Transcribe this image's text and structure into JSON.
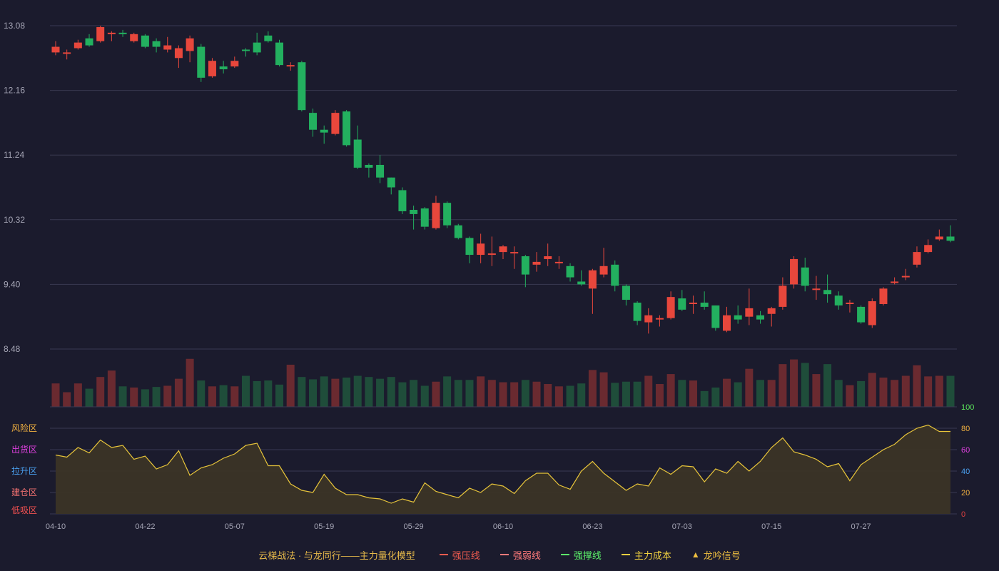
{
  "legend": {
    "title": "云梯战法 · 与龙同行——主力量化模型",
    "items": [
      {
        "label": "强压线",
        "color": "#f05b4f",
        "style": "solid"
      },
      {
        "label": "强弱线",
        "color": "#ff7a7a",
        "style": "dashed"
      },
      {
        "label": "强撑线",
        "color": "#5cf26a",
        "style": "solid"
      },
      {
        "label": "主力成本",
        "color": "#f0d040",
        "style": "dashed"
      },
      {
        "label": "龙吟信号",
        "color": "#f0c040",
        "style": "triangle"
      }
    ]
  },
  "colors": {
    "up": "#e8473c",
    "down": "#23b05f",
    "volume_up": "#6a2a30",
    "volume_down": "#1f4d3a",
    "grid": "#3a3a52",
    "axis_text": "#a5a5b5",
    "oscillator_line": "#e8c53a",
    "oscillator_fill": "#3b3426",
    "osc_100": "#5ce85c",
    "osc_80": "#f0b040",
    "osc_60": "#e040e0",
    "osc_40": "#4aa0f0",
    "osc_20": "#f0b040",
    "osc_0": "#e04040"
  },
  "chart_data": [
    {
      "type": "candlestick",
      "ylim": [
        8.48,
        13.08
      ],
      "y_ticks": [
        "13.08",
        "12.16",
        "11.24",
        "10.32",
        "9.40",
        "8.48"
      ],
      "x_ticks": [
        {
          "index": 0,
          "label": "04-10"
        },
        {
          "index": 8,
          "label": "04-22"
        },
        {
          "index": 16,
          "label": "05-07"
        },
        {
          "index": 24,
          "label": "05-19"
        },
        {
          "index": 32,
          "label": "05-29"
        },
        {
          "index": 40,
          "label": "06-10"
        },
        {
          "index": 48,
          "label": "06-23"
        },
        {
          "index": 56,
          "label": "07-03"
        },
        {
          "index": 64,
          "label": "07-15"
        },
        {
          "index": 72,
          "label": "07-27"
        }
      ],
      "ohlc": [
        [
          12.7,
          12.78,
          12.86,
          12.66
        ],
        [
          12.68,
          12.7,
          12.74,
          12.6
        ],
        [
          12.76,
          12.84,
          12.88,
          12.74
        ],
        [
          12.9,
          12.8,
          12.96,
          12.78
        ],
        [
          12.86,
          13.06,
          13.08,
          12.84
        ],
        [
          12.98,
          12.98,
          13.0,
          12.86
        ],
        [
          12.98,
          12.96,
          13.02,
          12.92
        ],
        [
          12.86,
          12.96,
          12.98,
          12.84
        ],
        [
          12.94,
          12.78,
          12.96,
          12.76
        ],
        [
          12.86,
          12.78,
          12.9,
          12.7
        ],
        [
          12.74,
          12.8,
          12.92,
          12.7
        ],
        [
          12.62,
          12.76,
          12.8,
          12.48
        ],
        [
          12.72,
          12.9,
          12.94,
          12.56
        ],
        [
          12.78,
          12.34,
          12.82,
          12.28
        ],
        [
          12.36,
          12.58,
          12.62,
          12.34
        ],
        [
          12.5,
          12.46,
          12.58,
          12.4
        ],
        [
          12.5,
          12.58,
          12.64,
          12.48
        ],
        [
          12.74,
          12.72,
          12.76,
          12.64
        ],
        [
          12.84,
          12.7,
          12.98,
          12.66
        ],
        [
          12.94,
          12.86,
          13.0,
          12.84
        ],
        [
          12.84,
          12.52,
          12.88,
          12.5
        ],
        [
          12.52,
          12.52,
          12.56,
          12.44
        ],
        [
          12.56,
          11.88,
          12.58,
          11.86
        ],
        [
          11.84,
          11.6,
          11.9,
          11.5
        ],
        [
          11.6,
          11.56,
          11.66,
          11.4
        ],
        [
          11.54,
          11.84,
          11.88,
          11.52
        ],
        [
          11.86,
          11.38,
          11.88,
          11.36
        ],
        [
          11.46,
          11.06,
          11.66,
          11.04
        ],
        [
          11.1,
          11.06,
          11.12,
          10.92
        ],
        [
          11.1,
          10.92,
          11.24,
          10.84
        ],
        [
          10.92,
          10.78,
          10.92,
          10.68
        ],
        [
          10.74,
          10.44,
          10.78,
          10.4
        ],
        [
          10.46,
          10.4,
          10.52,
          10.18
        ],
        [
          10.48,
          10.22,
          10.5,
          10.18
        ],
        [
          10.2,
          10.56,
          10.66,
          10.18
        ],
        [
          10.56,
          10.24,
          10.58,
          10.2
        ],
        [
          10.24,
          10.06,
          10.26,
          10.04
        ],
        [
          10.06,
          9.82,
          10.08,
          9.7
        ],
        [
          9.82,
          9.98,
          10.12,
          9.7
        ],
        [
          9.84,
          9.84,
          10.08,
          9.66
        ],
        [
          9.86,
          9.94,
          9.96,
          9.76
        ],
        [
          9.84,
          9.86,
          9.94,
          9.62
        ],
        [
          9.8,
          9.54,
          9.82,
          9.36
        ],
        [
          9.68,
          9.72,
          9.86,
          9.58
        ],
        [
          9.76,
          9.8,
          9.98,
          9.66
        ],
        [
          9.72,
          9.72,
          9.8,
          9.62
        ],
        [
          9.66,
          9.5,
          9.7,
          9.44
        ],
        [
          9.44,
          9.4,
          9.6,
          9.38
        ],
        [
          9.34,
          9.6,
          9.62,
          8.98
        ],
        [
          9.54,
          9.66,
          9.92,
          9.5
        ],
        [
          9.68,
          9.38,
          9.74,
          9.3
        ],
        [
          9.38,
          9.18,
          9.4,
          9.1
        ],
        [
          9.14,
          8.88,
          9.16,
          8.82
        ],
        [
          8.86,
          8.96,
          9.06,
          8.7
        ],
        [
          8.92,
          8.92,
          8.96,
          8.8
        ],
        [
          8.92,
          9.22,
          9.3,
          8.9
        ],
        [
          9.2,
          9.04,
          9.32,
          9.02
        ],
        [
          9.12,
          9.14,
          9.24,
          8.98
        ],
        [
          9.14,
          9.08,
          9.3,
          9.04
        ],
        [
          9.1,
          8.78,
          9.1,
          8.74
        ],
        [
          8.74,
          8.96,
          9.08,
          8.72
        ],
        [
          8.96,
          8.9,
          9.1,
          8.84
        ],
        [
          8.94,
          9.06,
          9.34,
          8.82
        ],
        [
          8.96,
          8.9,
          9.02,
          8.84
        ],
        [
          8.98,
          9.06,
          9.08,
          8.8
        ],
        [
          9.08,
          9.38,
          9.5,
          9.04
        ],
        [
          9.4,
          9.76,
          9.8,
          9.34
        ],
        [
          9.64,
          9.38,
          9.78,
          9.3
        ],
        [
          9.32,
          9.34,
          9.52,
          9.18
        ],
        [
          9.32,
          9.26,
          9.54,
          9.14
        ],
        [
          9.24,
          9.1,
          9.3,
          9.04
        ],
        [
          9.12,
          9.14,
          9.18,
          9.0
        ],
        [
          9.08,
          8.86,
          9.1,
          8.84
        ],
        [
          8.82,
          9.16,
          9.2,
          8.78
        ],
        [
          9.12,
          9.34,
          9.36,
          9.1
        ],
        [
          9.42,
          9.44,
          9.5,
          9.4
        ],
        [
          9.5,
          9.52,
          9.62,
          9.46
        ],
        [
          9.68,
          9.86,
          9.94,
          9.64
        ],
        [
          9.86,
          9.96,
          10.04,
          9.84
        ],
        [
          10.04,
          10.08,
          10.18,
          10.02
        ],
        [
          10.08,
          10.02,
          10.24,
          10.0
        ]
      ]
    },
    {
      "type": "bar",
      "title": "volume",
      "values": [
        40,
        25,
        40,
        31,
        51,
        62,
        35,
        33,
        30,
        34,
        36,
        48,
        82,
        45,
        35,
        37,
        35,
        53,
        44,
        45,
        38,
        72,
        51,
        47,
        52,
        48,
        50,
        53,
        51,
        48,
        51,
        42,
        46,
        36,
        43,
        52,
        46,
        46,
        52,
        46,
        42,
        42,
        46,
        43,
        39,
        35,
        36,
        40,
        63,
        59,
        41,
        43,
        43,
        53,
        39,
        56,
        46,
        45,
        27,
        33,
        48,
        42,
        65,
        46,
        46,
        73,
        81,
        75,
        56,
        73,
        46,
        37,
        44,
        58,
        50,
        46,
        53,
        71,
        52,
        53,
        53
      ]
    },
    {
      "type": "area",
      "title": "oscillator",
      "ylim": [
        0,
        100
      ],
      "y_ticks": [
        "100",
        "80",
        "60",
        "40",
        "20",
        "0"
      ],
      "zone_labels": [
        {
          "value": 80,
          "label": "风险区"
        },
        {
          "value": 60,
          "label": "出货区"
        },
        {
          "value": 40,
          "label": "拉升区"
        },
        {
          "value": 20,
          "label": "建仓区"
        },
        {
          "value": 0,
          "label": "低吸区"
        }
      ],
      "values": [
        55,
        53,
        62,
        57,
        69,
        62,
        64,
        51,
        54,
        42,
        46,
        59,
        36,
        43,
        46,
        52,
        56,
        64,
        66,
        45,
        45,
        28,
        22,
        20,
        37,
        24,
        18,
        18,
        15,
        14,
        10,
        14,
        11,
        29,
        21,
        18,
        15,
        24,
        20,
        28,
        26,
        19,
        31,
        38,
        38,
        27,
        23,
        40,
        49,
        38,
        30,
        22,
        28,
        26,
        43,
        37,
        45,
        44,
        30,
        42,
        38,
        49,
        40,
        49,
        62,
        71,
        58,
        55,
        51,
        44,
        47,
        31,
        46,
        53,
        60,
        65,
        74,
        80,
        83,
        77,
        77
      ]
    }
  ]
}
